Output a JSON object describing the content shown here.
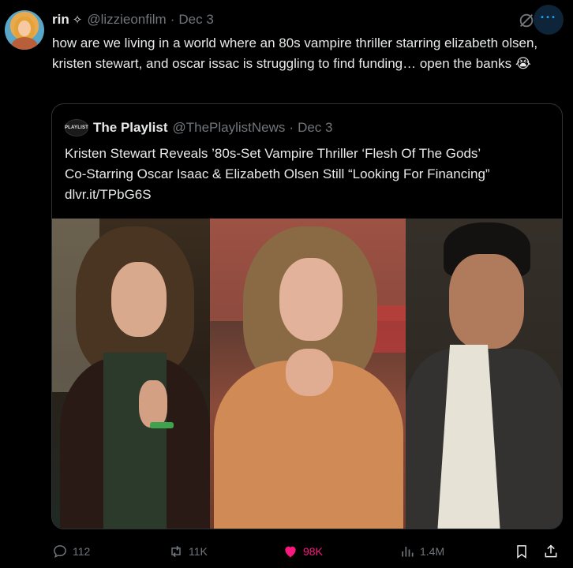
{
  "tweet": {
    "author_name": "rin",
    "author_badge": "✧",
    "handle": "@lizzieonfilm",
    "separator": "·",
    "date": "Dec 3",
    "text": "how are we living in a world where an 80s vampire thriller starring elizabeth olsen, kristen stewart, and oscar issac is struggling to find funding… open the banks 😭",
    "more_label": "···"
  },
  "quote": {
    "logo_text": "PLAYLIST",
    "author_name": "The Playlist",
    "handle": "@ThePlaylistNews",
    "separator": "·",
    "date": "Dec 3",
    "text_line1": "Kristen Stewart Reveals ’80s-Set Vampire Thriller ‘Flesh Of The Gods’",
    "text_line2": "Co-Starring Oscar Isaac & Elizabeth Olsen Still “Looking For Financing”",
    "link": "dlvr.it/TPbG6S"
  },
  "actions": {
    "replies": "112",
    "reposts": "11K",
    "likes": "98K",
    "views": "1.4M"
  },
  "colors": {
    "background": "#000000",
    "text": "#e7e9ea",
    "muted": "#71767b",
    "like": "#f91880",
    "accent": "#1d9bf0",
    "border": "#2f3336"
  },
  "icons": [
    "grok-icon",
    "more-icon",
    "reply-icon",
    "repost-icon",
    "like-icon",
    "views-icon",
    "bookmark-icon",
    "share-icon"
  ]
}
